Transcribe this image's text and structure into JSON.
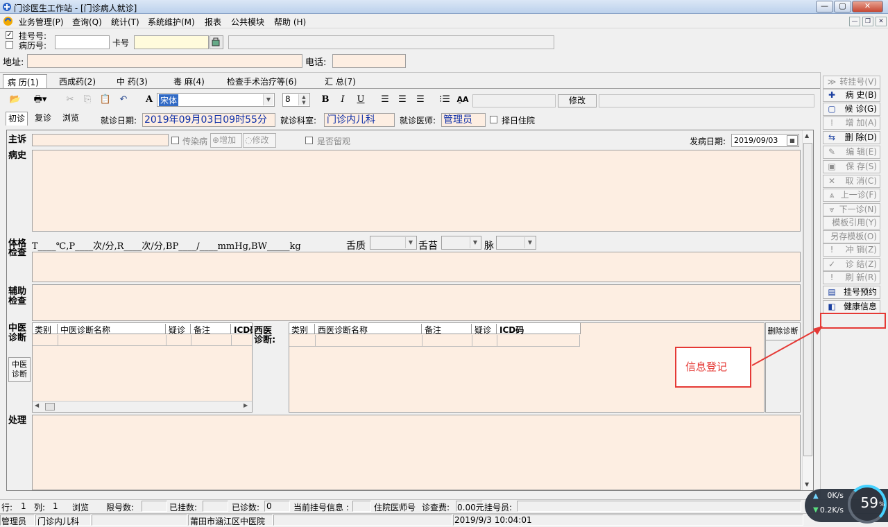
{
  "window": {
    "title": "门诊医生工作站 - [门诊病人就诊]",
    "min": "—",
    "max": "▢",
    "close": "✕"
  },
  "menu": [
    "业务管理(P)",
    "查询(Q)",
    "统计(T)",
    "系统维护(M)",
    "报表",
    "公共模块",
    "帮助 (H)"
  ],
  "top": {
    "reg_label": "挂号号:",
    "rec_label": "病历号:",
    "card_label": "卡号",
    "addr_label": "地址:",
    "phone_label": "电话:",
    "reg_checked": true,
    "rec_checked": false
  },
  "tabs": [
    "病 历(1)",
    "西成药(2)",
    "中 药(3)",
    "毒 麻(4)",
    "检查手术治疗等(6)",
    "汇 总(7)"
  ],
  "toolbar": {
    "font_name": "宋体",
    "font_size": "8",
    "modify": "修改"
  },
  "visit": {
    "subtabs": [
      "初诊",
      "复诊",
      "浏览"
    ],
    "date_label": "就诊日期:",
    "date_value": "2019年09月03日09时55分",
    "dept_label": "就诊科室:",
    "dept_value": "门诊内儿科",
    "doctor_label": "就诊医师:",
    "doctor_value": "管理员",
    "select_date": "择日住院"
  },
  "record": {
    "chief": "主诉",
    "infect": "传染病",
    "add": "增加",
    "modify": "修改",
    "observe": "是否留观",
    "onset_label": "发病日期:",
    "onset_value": "2019/09/03",
    "history": "病史",
    "exam1": "体格",
    "exam2": "检查",
    "vitals": "T____℃,P____次/分,R____次/分,BP____/____mmHg,BW_____kg",
    "tongue": "舌质",
    "coating": "舌苔",
    "pulse": "脉",
    "aux1": "辅助",
    "aux2": "检查",
    "tcm1": "中医",
    "tcm2": "诊断",
    "tcm_btn1": "中医",
    "tcm_btn2": "诊断",
    "west1": "西医",
    "west2": "诊断:",
    "delete_diag": "删除诊断",
    "treat": "处理"
  },
  "tcm_cols": [
    "类别",
    "中医诊断名称",
    "疑诊",
    "备注",
    "ICD码"
  ],
  "west_cols": [
    "类别",
    "西医诊断名称",
    "备注",
    "疑诊",
    "ICD码"
  ],
  "right_buttons": [
    {
      "icon": "≫",
      "label": "转挂号(V)",
      "enabled": false
    },
    {
      "icon": "✚",
      "label": "病  史(B)",
      "enabled": true
    },
    {
      "icon": "▢",
      "label": "候  诊(G)",
      "enabled": true
    },
    {
      "icon": "⁞",
      "label": "增  加(A)",
      "enabled": false
    },
    {
      "icon": "⇆",
      "label": "删  除(D)",
      "enabled": true
    },
    {
      "icon": "✎",
      "label": "编  辑(E)",
      "enabled": false
    },
    {
      "icon": "▣",
      "label": "保  存(S)",
      "enabled": false
    },
    {
      "icon": "✕",
      "label": "取  消(C)",
      "enabled": false
    },
    {
      "icon": "⩓",
      "label": "上一诊(F)",
      "enabled": false
    },
    {
      "icon": "⩔",
      "label": "下一诊(N)",
      "enabled": false
    },
    {
      "icon": "",
      "label": "模板引用(Y)",
      "enabled": false
    },
    {
      "icon": "",
      "label": "另存模板(O)",
      "enabled": false
    },
    {
      "icon": "!",
      "label": "冲  销(Z)",
      "enabled": false
    },
    {
      "icon": "✓",
      "label": "诊  结(Z)",
      "enabled": false
    },
    {
      "icon": "!",
      "label": "刷  新(R)",
      "enabled": false
    },
    {
      "icon": "▤",
      "label": "挂号预约",
      "enabled": true
    },
    {
      "icon": "◧",
      "label": "健康信息",
      "enabled": true
    }
  ],
  "annotation": {
    "text": "信息登记",
    "color": "#e53935"
  },
  "status1": {
    "row_label": "行:",
    "row": "1",
    "col_label": "列:",
    "col": "1",
    "mode": "浏览",
    "limit": "限号数:",
    "registered": "已挂数:",
    "diagnosed": "已诊数:",
    "diagnosed_val": "0",
    "cur_reg": "当前挂号信息 :",
    "inpatient_doc": "住院医师号",
    "fee_label": "诊查费:",
    "fee": "0.00元",
    "reg_staff": "挂号员:"
  },
  "status2": {
    "user": "管理员",
    "dept": "门诊内儿科",
    "hospital": "莆田市涵江区中医院",
    "time": "2019/9/3 10:04:01"
  },
  "net": {
    "up": "0K/s",
    "down": "0.2K/s",
    "percent": "59",
    "unit": "%"
  }
}
